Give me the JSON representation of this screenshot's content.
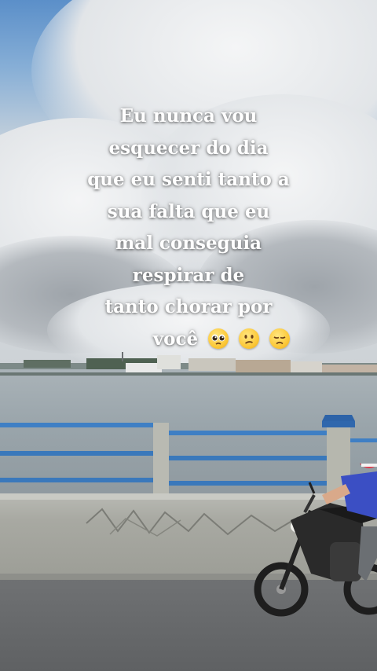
{
  "caption": {
    "lines": [
      "Eu nunca vou",
      "esquecer do dia",
      "que eu senti tanto a",
      "sua falta que eu",
      "mal conseguia",
      "respirar de",
      "tanto chorar por"
    ],
    "last_word": "você",
    "emojis": [
      "pleading-face-icon",
      "confused-face-icon",
      "disappointed-face-icon"
    ],
    "text_color": "#ffffff"
  },
  "scene": {
    "sky_color": "#86aed6",
    "water_color": "#9aa5ab",
    "railing_color": "#3f7fc4"
  }
}
